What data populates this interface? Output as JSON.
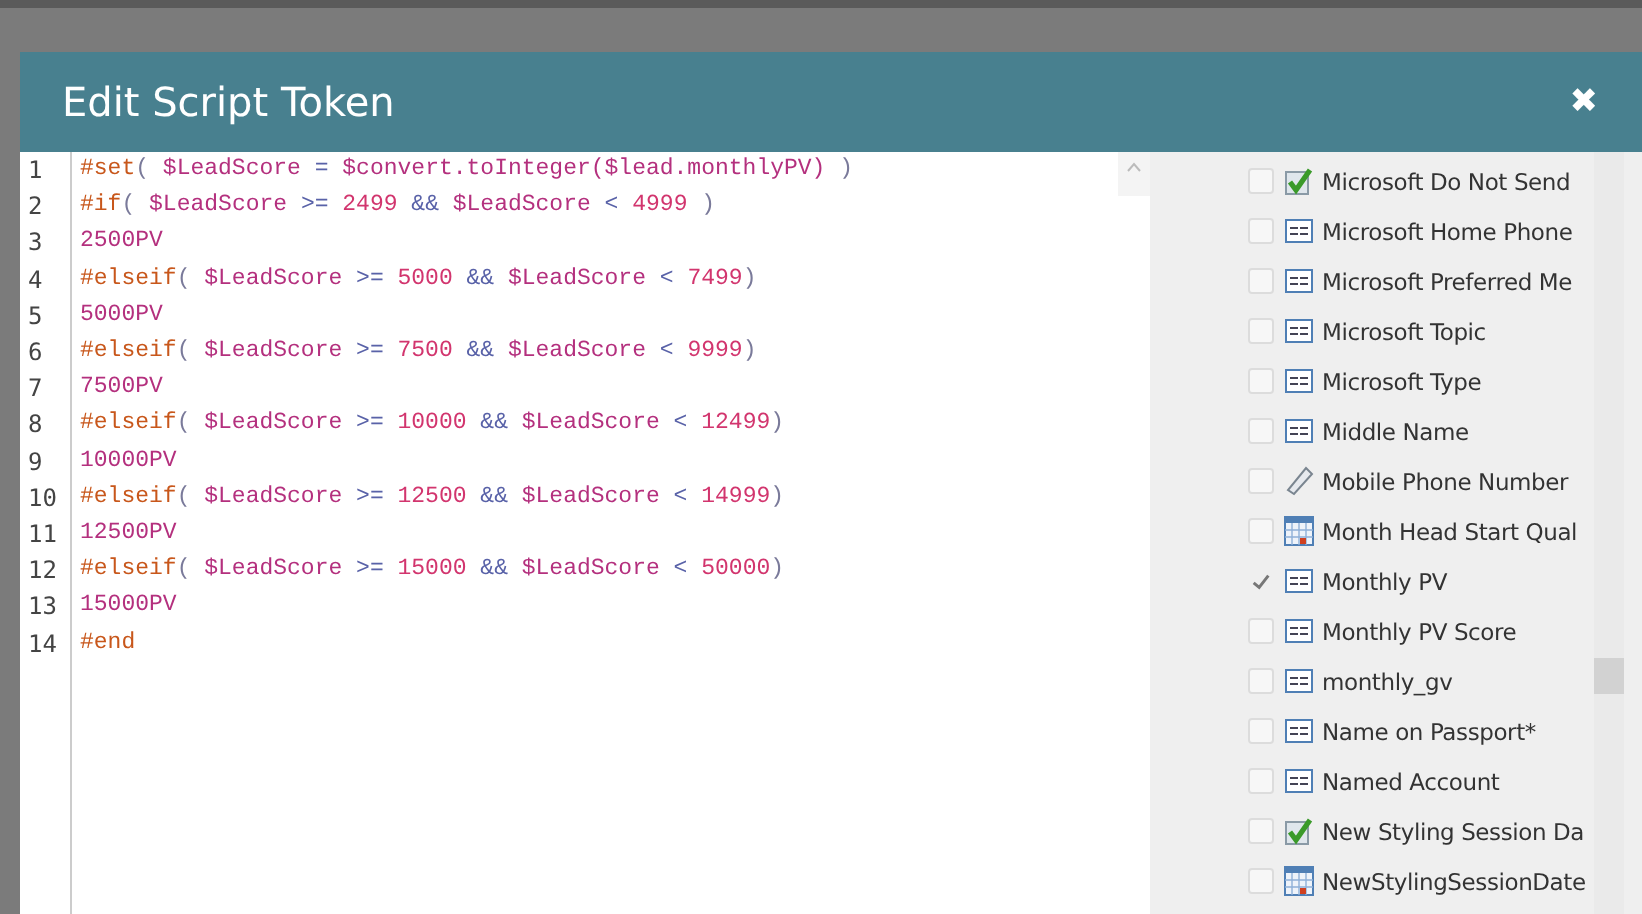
{
  "dialog": {
    "title": "Edit Script Token",
    "close": "✖"
  },
  "code_lines": [
    {
      "number": "1",
      "tokens": [
        {
          "kind": "directive",
          "text": "#set"
        },
        {
          "kind": "punct",
          "text": "( "
        },
        {
          "kind": "variable",
          "text": "$LeadScore"
        },
        {
          "kind": "operator",
          "text": " = "
        },
        {
          "kind": "variable",
          "text": "$convert.toInteger($lead.monthlyPV)"
        },
        {
          "kind": "punct",
          "text": " )"
        }
      ]
    },
    {
      "number": "2",
      "tokens": [
        {
          "kind": "directive",
          "text": "#if"
        },
        {
          "kind": "punct",
          "text": "( "
        },
        {
          "kind": "variable",
          "text": "$LeadScore"
        },
        {
          "kind": "operator",
          "text": " >= "
        },
        {
          "kind": "number",
          "text": "2499"
        },
        {
          "kind": "operator",
          "text": " && "
        },
        {
          "kind": "variable",
          "text": "$LeadScore"
        },
        {
          "kind": "operator",
          "text": " < "
        },
        {
          "kind": "number",
          "text": "4999"
        },
        {
          "kind": "punct",
          "text": " )"
        }
      ]
    },
    {
      "number": "3",
      "tokens": [
        {
          "kind": "variable",
          "text": "2500PV"
        }
      ]
    },
    {
      "number": "4",
      "tokens": [
        {
          "kind": "directive",
          "text": "#elseif"
        },
        {
          "kind": "punct",
          "text": "( "
        },
        {
          "kind": "variable",
          "text": "$LeadScore"
        },
        {
          "kind": "operator",
          "text": " >= "
        },
        {
          "kind": "number",
          "text": "5000"
        },
        {
          "kind": "operator",
          "text": " && "
        },
        {
          "kind": "variable",
          "text": "$LeadScore"
        },
        {
          "kind": "operator",
          "text": " < "
        },
        {
          "kind": "number",
          "text": "7499"
        },
        {
          "kind": "punct",
          "text": ")"
        }
      ]
    },
    {
      "number": "5",
      "tokens": [
        {
          "kind": "variable",
          "text": "5000PV"
        }
      ]
    },
    {
      "number": "6",
      "tokens": [
        {
          "kind": "directive",
          "text": "#elseif"
        },
        {
          "kind": "punct",
          "text": "( "
        },
        {
          "kind": "variable",
          "text": "$LeadScore"
        },
        {
          "kind": "operator",
          "text": " >= "
        },
        {
          "kind": "number",
          "text": "7500"
        },
        {
          "kind": "operator",
          "text": " && "
        },
        {
          "kind": "variable",
          "text": "$LeadScore"
        },
        {
          "kind": "operator",
          "text": " < "
        },
        {
          "kind": "number",
          "text": "9999"
        },
        {
          "kind": "punct",
          "text": ")"
        }
      ]
    },
    {
      "number": "7",
      "tokens": [
        {
          "kind": "variable",
          "text": "7500PV"
        }
      ]
    },
    {
      "number": "8",
      "tokens": [
        {
          "kind": "directive",
          "text": "#elseif"
        },
        {
          "kind": "punct",
          "text": "( "
        },
        {
          "kind": "variable",
          "text": "$LeadScore"
        },
        {
          "kind": "operator",
          "text": " >= "
        },
        {
          "kind": "number",
          "text": "10000"
        },
        {
          "kind": "operator",
          "text": " && "
        },
        {
          "kind": "variable",
          "text": "$LeadScore"
        },
        {
          "kind": "operator",
          "text": " < "
        },
        {
          "kind": "number",
          "text": "12499"
        },
        {
          "kind": "punct",
          "text": ")"
        }
      ]
    },
    {
      "number": "9",
      "tokens": [
        {
          "kind": "variable",
          "text": "10000PV"
        }
      ]
    },
    {
      "number": "10",
      "tokens": [
        {
          "kind": "directive",
          "text": "#elseif"
        },
        {
          "kind": "punct",
          "text": "( "
        },
        {
          "kind": "variable",
          "text": "$LeadScore"
        },
        {
          "kind": "operator",
          "text": " >= "
        },
        {
          "kind": "number",
          "text": "12500"
        },
        {
          "kind": "operator",
          "text": " && "
        },
        {
          "kind": "variable",
          "text": "$LeadScore"
        },
        {
          "kind": "operator",
          "text": " < "
        },
        {
          "kind": "number",
          "text": "14999"
        },
        {
          "kind": "punct",
          "text": ")"
        }
      ]
    },
    {
      "number": "11",
      "tokens": [
        {
          "kind": "variable",
          "text": "12500PV"
        }
      ]
    },
    {
      "number": "12",
      "tokens": [
        {
          "kind": "directive",
          "text": "#elseif"
        },
        {
          "kind": "punct",
          "text": "( "
        },
        {
          "kind": "variable",
          "text": "$LeadScore"
        },
        {
          "kind": "operator",
          "text": " >= "
        },
        {
          "kind": "number",
          "text": "15000"
        },
        {
          "kind": "operator",
          "text": " && "
        },
        {
          "kind": "variable",
          "text": "$LeadScore"
        },
        {
          "kind": "operator",
          "text": " < "
        },
        {
          "kind": "number",
          "text": "50000"
        },
        {
          "kind": "punct",
          "text": ")"
        }
      ]
    },
    {
      "number": "13",
      "tokens": [
        {
          "kind": "variable",
          "text": "15000PV"
        }
      ]
    },
    {
      "number": "14",
      "tokens": [
        {
          "kind": "directive",
          "text": "#end"
        }
      ]
    }
  ],
  "fields": [
    {
      "kind": "boolean",
      "label": "Microsoft Do Not Send",
      "checked": false
    },
    {
      "kind": "string",
      "label": "Microsoft Home Phone",
      "checked": false
    },
    {
      "kind": "string",
      "label": "Microsoft Preferred Me",
      "checked": false
    },
    {
      "kind": "string",
      "label": "Microsoft Topic",
      "checked": false
    },
    {
      "kind": "string",
      "label": "Microsoft Type",
      "checked": false
    },
    {
      "kind": "string",
      "label": "Middle Name",
      "checked": false
    },
    {
      "kind": "phone",
      "label": "Mobile Phone Number",
      "checked": false
    },
    {
      "kind": "date",
      "label": "Month Head Start Qual",
      "checked": false
    },
    {
      "kind": "string",
      "label": "Monthly PV",
      "checked": true
    },
    {
      "kind": "string",
      "label": "Monthly PV Score",
      "checked": false
    },
    {
      "kind": "string",
      "label": "monthly_gv",
      "checked": false
    },
    {
      "kind": "string",
      "label": "Name on Passport*",
      "checked": false
    },
    {
      "kind": "string",
      "label": "Named Account",
      "checked": false
    },
    {
      "kind": "boolean",
      "label": "New Styling Session Da",
      "checked": false
    },
    {
      "kind": "date",
      "label": "NewStylingSessionDate",
      "checked": false
    }
  ]
}
